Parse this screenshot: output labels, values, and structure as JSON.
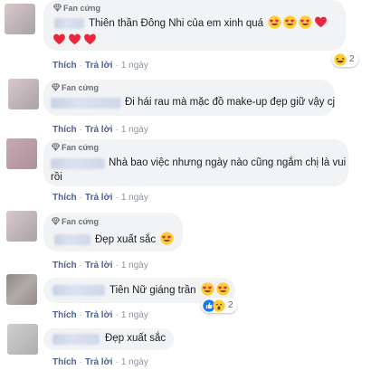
{
  "comments": [
    {
      "badge": "Fan cứng",
      "text": "Thiên thần Đông Nhi của em xinh quá",
      "text2": "",
      "like": "Thích",
      "reply": "Trả lời",
      "time": "1 ngày",
      "reactions_count": "2"
    },
    {
      "badge": "Fan cứng",
      "text": "Đi hái rau mà mặc đồ make-up đẹp giữ vậy cj",
      "text2": "",
      "like": "Thích",
      "reply": "Trả lời",
      "time": "1 ngày",
      "reactions_count": ""
    },
    {
      "badge": "Fan cứng",
      "text": "Nhà bao việc nhưng ngày nào cũng ngắm chị là vui",
      "text2": "rồi",
      "like": "Thích",
      "reply": "Trả lời",
      "time": "1 ngày",
      "reactions_count": ""
    },
    {
      "badge": "Fan cứng",
      "text": "Đẹp xuất sắc",
      "text2": "",
      "like": "Thích",
      "reply": "Trả lời",
      "time": "1 ngày",
      "reactions_count": ""
    },
    {
      "badge": "",
      "text": "Tiên Nữ giáng trần",
      "text2": "",
      "like": "Thích",
      "reply": "Trả lời",
      "time": "1 ngày",
      "reactions_count": "2"
    },
    {
      "badge": "",
      "text": "Đẹp xuất sắc",
      "text2": "",
      "like": "Thích",
      "reply": "Trả lời",
      "time": "1 ngày",
      "reactions_count": ""
    }
  ],
  "icons": {
    "badge": "diamond-icon",
    "heart_eyes": "heart-eyes-emoji",
    "heart": "red-heart-emoji",
    "laugh": "laugh-reaction-icon",
    "like": "like-reaction-icon",
    "wow": "wow-reaction-icon"
  },
  "colors": {
    "link": "#4b6296",
    "bubble": "#f2f3f5",
    "heart": "#f33e58"
  }
}
